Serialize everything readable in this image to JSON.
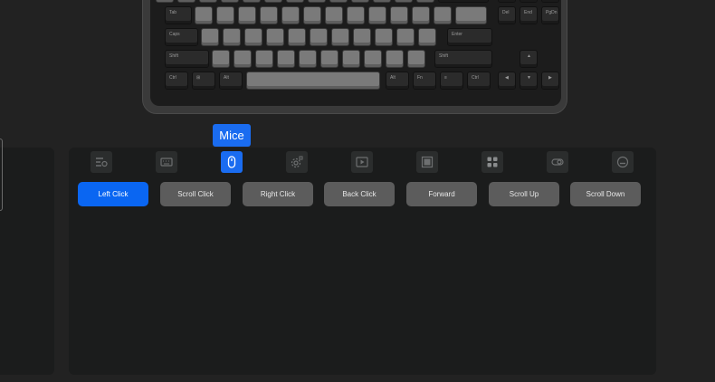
{
  "tooltip": {
    "label": "Mice"
  },
  "keyboard": {
    "keys": {
      "tab": "Tab",
      "caps": "Caps",
      "shift_l": "Shift",
      "shift_r": "Shift",
      "enter": "Enter",
      "ctrl_l": "Ctrl",
      "alt_l": "Alt",
      "alt_r": "Alt",
      "fn": "Fn",
      "ctrl_r": "Ctrl",
      "del": "Del",
      "end": "End",
      "pgdn": "PgDn",
      "backslash": "\\"
    }
  },
  "tabs": [
    {
      "name": "macro-tab",
      "icon": "macro-icon"
    },
    {
      "name": "keyboard-tab",
      "icon": "keyboard-icon"
    },
    {
      "name": "mice-tab",
      "icon": "mouse-icon",
      "active": true
    },
    {
      "name": "function-tab",
      "icon": "gear-icon"
    },
    {
      "name": "media-tab",
      "icon": "play-icon"
    },
    {
      "name": "window-tab",
      "icon": "window-icon"
    },
    {
      "name": "apps-tab",
      "icon": "apps-icon"
    },
    {
      "name": "light-tab",
      "icon": "toggle-icon"
    },
    {
      "name": "disable-tab",
      "icon": "disable-icon"
    }
  ],
  "actions": [
    {
      "label": "Left Click",
      "active": true
    },
    {
      "label": "Scroll Click"
    },
    {
      "label": "Right Click"
    },
    {
      "label": "Back Click"
    },
    {
      "label": "Forward"
    },
    {
      "label": "Scroll Up"
    },
    {
      "label": "Scroll Down"
    }
  ],
  "colors": {
    "accent": "#1a6cf0",
    "panel": "#1b1c1c",
    "button": "#5c5c5c",
    "background": "#222222"
  }
}
